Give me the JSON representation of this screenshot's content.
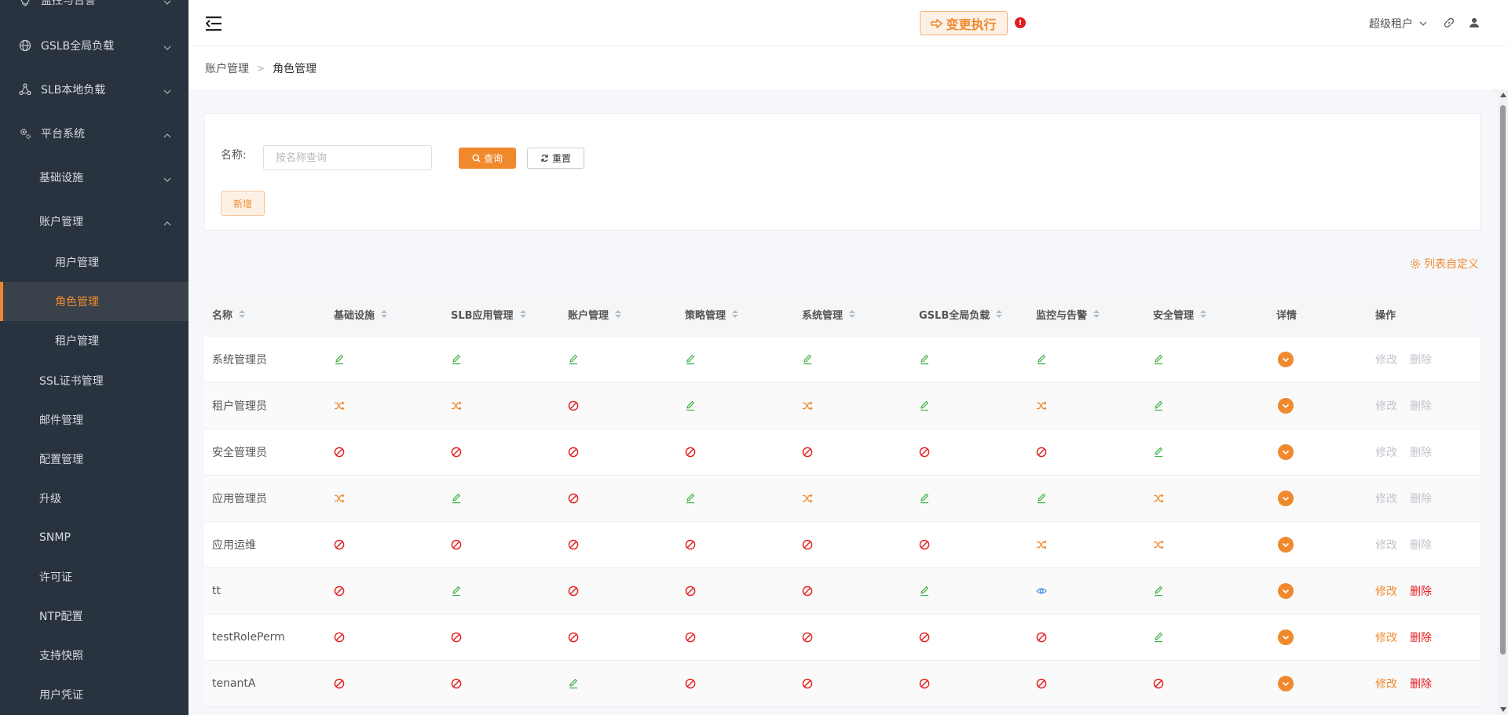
{
  "sidebar": {
    "items": [
      {
        "label": "监控与告警",
        "icon": "bulb-icon",
        "chevron": "down"
      },
      {
        "label": "GSLB全局负载",
        "icon": "globe-icon",
        "chevron": "down"
      },
      {
        "label": "SLB本地负载",
        "icon": "network-icon",
        "chevron": "down"
      },
      {
        "label": "平台系统",
        "icon": "gears-icon",
        "chevron": "up"
      },
      {
        "label": "基础设施",
        "chevron": "down"
      },
      {
        "label": "账户管理",
        "chevron": "up"
      },
      {
        "label": "用户管理"
      },
      {
        "label": "角色管理",
        "active": true
      },
      {
        "label": "租户管理"
      },
      {
        "label": "SSL证书管理"
      },
      {
        "label": "邮件管理"
      },
      {
        "label": "配置管理"
      },
      {
        "label": "升级"
      },
      {
        "label": "SNMP"
      },
      {
        "label": "许可证"
      },
      {
        "label": "NTP配置"
      },
      {
        "label": "支持快照"
      },
      {
        "label": "用户凭证"
      }
    ]
  },
  "header": {
    "exec_label": "变更执行",
    "alert": "!",
    "tenant": "超级租户"
  },
  "breadcrumb": {
    "parent": "账户管理",
    "current": "角色管理"
  },
  "filter": {
    "name_label": "名称:",
    "name_placeholder": "按名称查询",
    "query_label": "查询",
    "reset_label": "重置",
    "add_label": "新增"
  },
  "customize_label": "列表自定义",
  "table": {
    "columns": [
      "名称",
      "基础设施",
      "SLB应用管理",
      "账户管理",
      "策略管理",
      "系统管理",
      "GSLB全局负载",
      "监控与告警",
      "安全管理",
      "详情",
      "操作"
    ],
    "edit_label": "修改",
    "delete_label": "删除",
    "rows": [
      {
        "name": "系统管理员",
        "perms": [
          "edit",
          "edit",
          "edit",
          "edit",
          "edit",
          "edit",
          "edit",
          "edit"
        ],
        "ops_enabled": false
      },
      {
        "name": "租户管理员",
        "perms": [
          "shuffle",
          "shuffle",
          "deny",
          "edit",
          "shuffle",
          "edit",
          "shuffle",
          "edit"
        ],
        "ops_enabled": false
      },
      {
        "name": "安全管理员",
        "perms": [
          "deny",
          "deny",
          "deny",
          "deny",
          "deny",
          "deny",
          "deny",
          "edit"
        ],
        "ops_enabled": false
      },
      {
        "name": "应用管理员",
        "perms": [
          "shuffle",
          "edit",
          "deny",
          "edit",
          "shuffle",
          "edit",
          "edit",
          "shuffle"
        ],
        "ops_enabled": false
      },
      {
        "name": "应用运维",
        "perms": [
          "deny",
          "deny",
          "deny",
          "deny",
          "deny",
          "deny",
          "shuffle",
          "shuffle"
        ],
        "ops_enabled": false
      },
      {
        "name": "tt",
        "perms": [
          "deny",
          "edit",
          "deny",
          "deny",
          "deny",
          "edit",
          "view",
          "edit"
        ],
        "ops_enabled": true
      },
      {
        "name": "testRolePerm",
        "perms": [
          "deny",
          "deny",
          "deny",
          "deny",
          "deny",
          "deny",
          "deny",
          "edit"
        ],
        "ops_enabled": true
      },
      {
        "name": "tenantA",
        "perms": [
          "deny",
          "deny",
          "edit",
          "deny",
          "deny",
          "deny",
          "deny",
          "deny"
        ],
        "ops_enabled": true
      }
    ]
  },
  "colors": {
    "accent": "#f0892e",
    "edit": "#3cb043",
    "shuffle": "#f0892e",
    "deny": "#e41b1b",
    "view": "#4a90e2",
    "sidebar_bg": "#29333f"
  }
}
